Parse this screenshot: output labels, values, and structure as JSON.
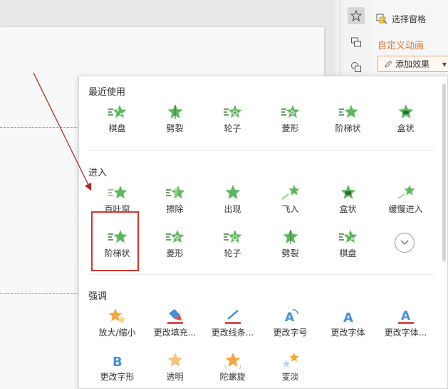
{
  "task_pane": {
    "select_pane_label": "选择窗格",
    "title": "自定义动画",
    "add_effect_label": "添加效果"
  },
  "dropdown": {
    "sections": [
      {
        "title": "最近使用",
        "rows": [
          [
            {
              "label": "棋盘",
              "icon": "checkerboard-icon"
            },
            {
              "label": "劈裂",
              "icon": "split-icon"
            },
            {
              "label": "轮子",
              "icon": "wheel-icon"
            },
            {
              "label": "菱形",
              "icon": "diamond-icon"
            },
            {
              "label": "阶梯状",
              "icon": "stairs-icon"
            },
            {
              "label": "盒状",
              "icon": "box-icon"
            }
          ]
        ]
      },
      {
        "title": "进入",
        "rows": [
          [
            {
              "label": "百叶窗",
              "icon": "blinds-icon"
            },
            {
              "label": "擦除",
              "icon": "wipe-icon"
            },
            {
              "label": "出现",
              "icon": "appear-icon"
            },
            {
              "label": "飞入",
              "icon": "fly-in-icon"
            },
            {
              "label": "盒状",
              "icon": "box-icon"
            },
            {
              "label": "缓慢进入",
              "icon": "crawl-in-icon"
            }
          ],
          [
            {
              "label": "阶梯状",
              "icon": "stairs-icon"
            },
            {
              "label": "菱形",
              "icon": "diamond-icon"
            },
            {
              "label": "轮子",
              "icon": "wheel-icon"
            },
            {
              "label": "劈裂",
              "icon": "split-icon"
            },
            {
              "label": "棋盘",
              "icon": "checkerboard-icon"
            }
          ]
        ]
      },
      {
        "title": "强调",
        "rows": [
          [
            {
              "label": "放大/缩小",
              "icon": "grow-shrink-icon"
            },
            {
              "label": "更改填充...",
              "icon": "fill-color-icon"
            },
            {
              "label": "更改线条...",
              "icon": "line-color-icon"
            },
            {
              "label": "更改字号",
              "icon": "font-size-icon"
            },
            {
              "label": "更改字体",
              "icon": "font-icon"
            },
            {
              "label": "更改字体...",
              "icon": "font-color-icon"
            }
          ],
          [
            {
              "label": "更改字形",
              "icon": "font-style-icon"
            },
            {
              "label": "透明",
              "icon": "transparency-icon"
            },
            {
              "label": "陀螺旋",
              "icon": "spin-icon"
            },
            {
              "label": "变淡",
              "icon": "fade-icon"
            }
          ]
        ]
      }
    ]
  },
  "colors": {
    "entrance_green": "#5cb85c",
    "emphasis_orange": "#f4a540",
    "emphasis_blue": "#4a90d9",
    "accent_orange": "#e0712c",
    "annotation_red": "#d6352e"
  }
}
